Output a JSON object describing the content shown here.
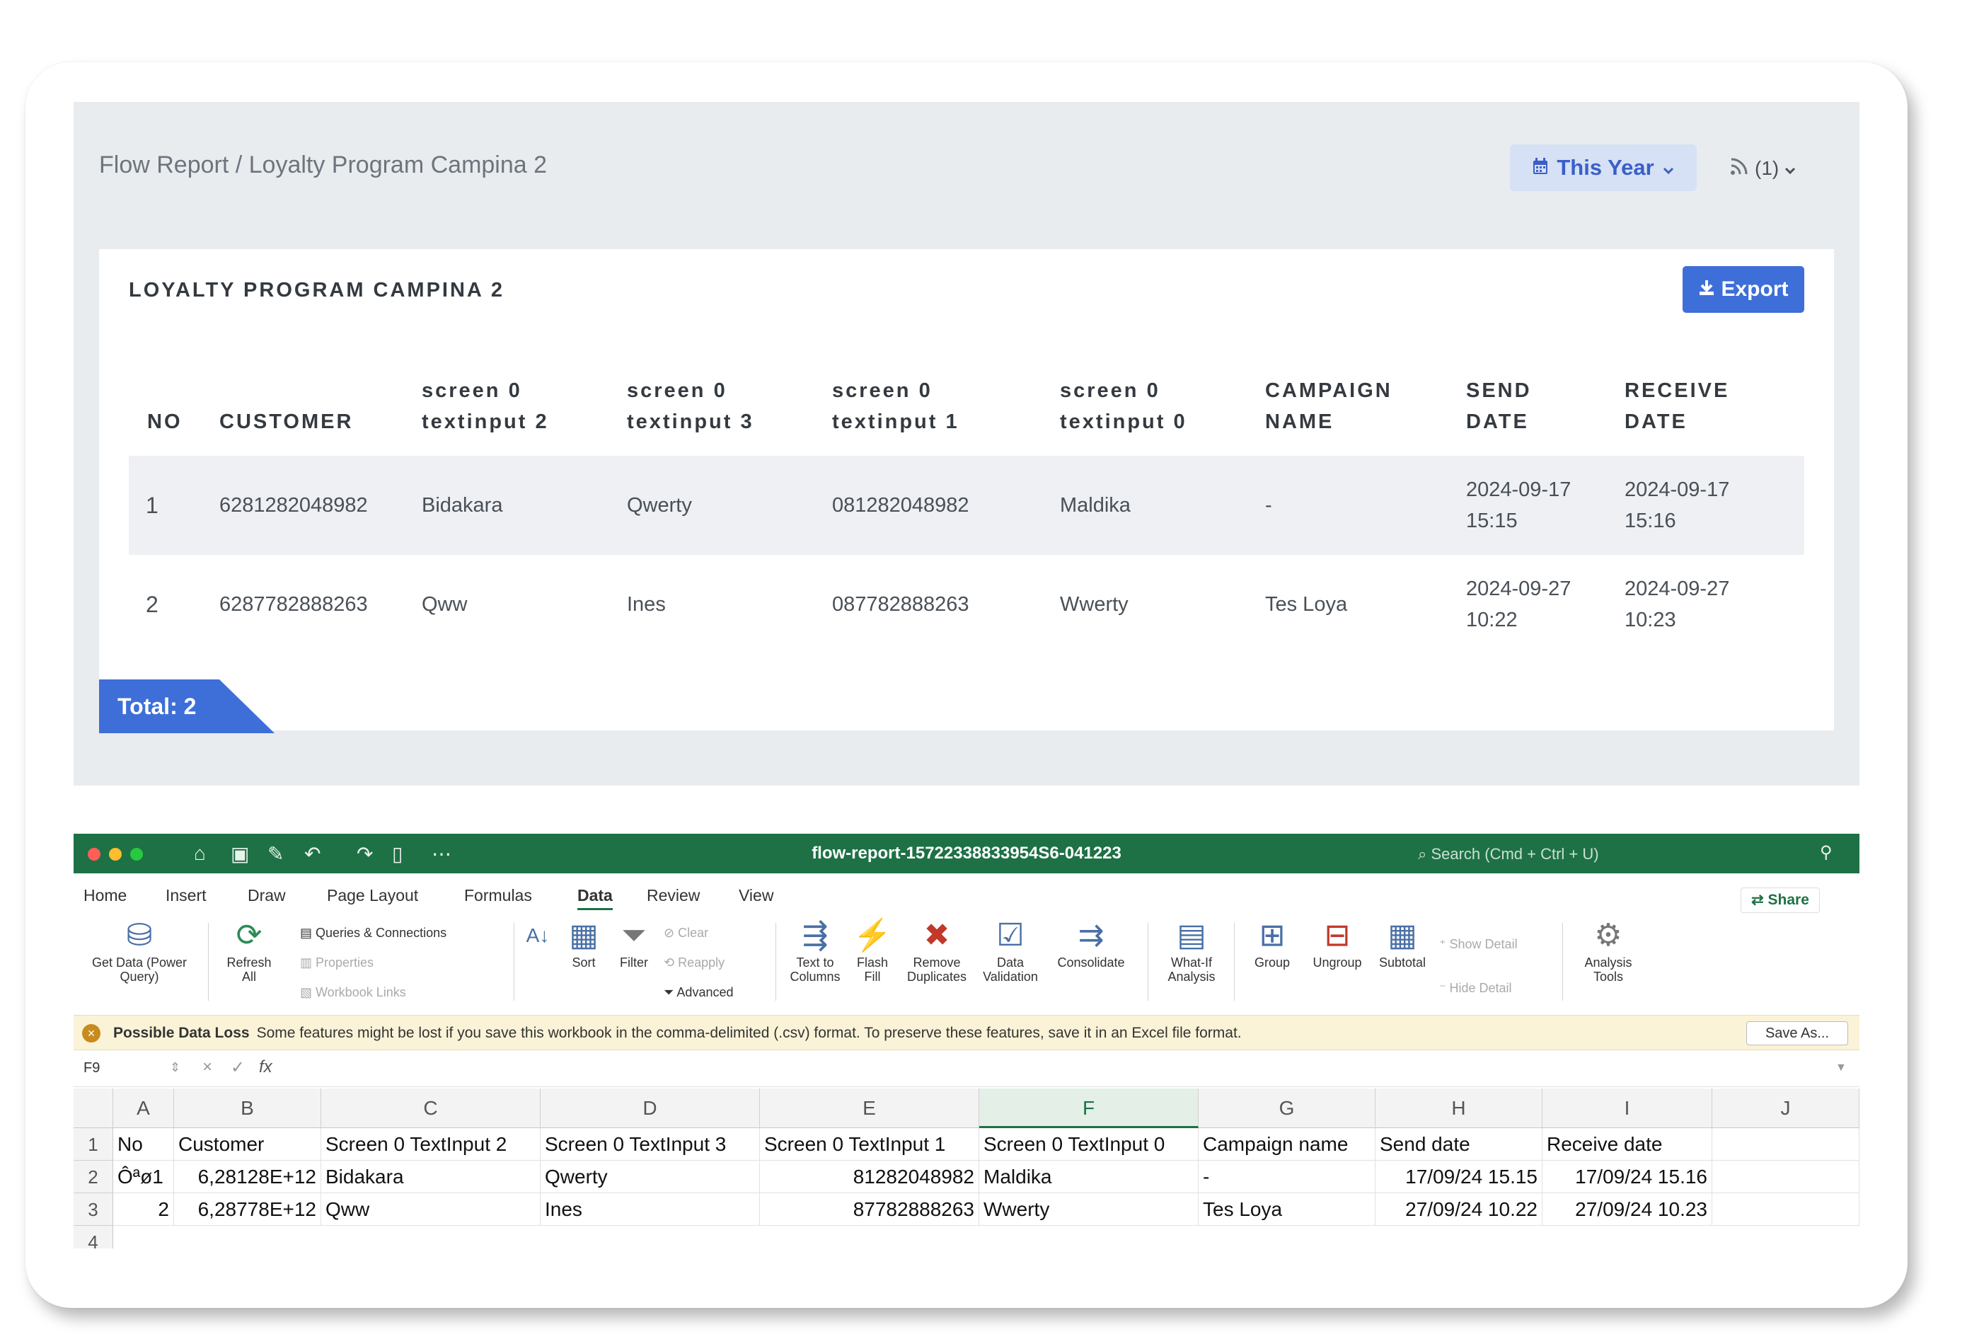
{
  "report": {
    "breadcrumb": "Flow Report / Loyalty Program Campina 2",
    "period_button": "This Year",
    "feed_count": "(1)",
    "panel_title": "LOYALTY PROGRAM CAMPINA 2",
    "export_label": "Export",
    "headers": {
      "no": "NO",
      "customer": "CUSTOMER",
      "ti2_a": "screen 0",
      "ti2_b": "textinput 2",
      "ti3_a": "screen 0",
      "ti3_b": "textinput 3",
      "ti1_a": "screen 0",
      "ti1_b": "textinput 1",
      "ti0_a": "screen 0",
      "ti0_b": "textinput 0",
      "campaign_a": "CAMPAIGN",
      "campaign_b": "NAME",
      "send_a": "SEND",
      "send_b": "DATE",
      "recv_a": "RECEIVE",
      "recv_b": "DATE"
    },
    "rows": [
      {
        "no": "1",
        "customer": "6281282048982",
        "ti2": "Bidakara",
        "ti3": "Qwerty",
        "ti1": "081282048982",
        "ti0": "Maldika",
        "campaign": "-",
        "send_date": "2024-09-17",
        "send_time": "15:15",
        "recv_date": "2024-09-17",
        "recv_time": "15:16"
      },
      {
        "no": "2",
        "customer": "6287782888263",
        "ti2": "Qww",
        "ti3": "Ines",
        "ti1": "087782888263",
        "ti0": "Wwerty",
        "campaign": "Tes Loya",
        "send_date": "2024-09-27",
        "send_time": "10:22",
        "recv_date": "2024-09-27",
        "recv_time": "10:23"
      }
    ],
    "total": "Total: 2",
    "colors": {
      "accent": "#3e6fd8",
      "page_bg": "#e9ecef"
    }
  },
  "excel": {
    "file_title": "flow-report-15722338833954S6-041223",
    "search_placeholder": "Search (Cmd + Ctrl + U)",
    "tabs": [
      "Home",
      "Insert",
      "Draw",
      "Page Layout",
      "Formulas",
      "Data",
      "Review",
      "View"
    ],
    "share_label": "Share",
    "ribbon": {
      "get_data": "Get Data (Power Query)",
      "refresh_all": "Refresh All",
      "queries": "Queries & Connections",
      "properties": "Properties",
      "workbook_links": "Workbook Links",
      "sort": "Sort",
      "filter": "Filter",
      "clear": "Clear",
      "reapply": "Reapply",
      "advanced": "Advanced",
      "text_to_columns": "Text to Columns",
      "flash_fill": "Flash Fill",
      "remove_duplicates": "Remove Duplicates",
      "data_validation": "Data Validation",
      "consolidate": "Consolidate",
      "what_if": "What-If Analysis",
      "group": "Group",
      "ungroup": "Ungroup",
      "subtotal": "Subtotal",
      "show_detail": "Show Detail",
      "hide_detail": "Hide Detail",
      "analysis_tools": "Analysis Tools"
    },
    "warning_title": "Possible Data Loss",
    "warning_text": "Some features might be lost if you save this workbook in the comma-delimited (.csv) format. To preserve these features, save it in an Excel file format.",
    "save_as": "Save As...",
    "name_box": "F9",
    "columns": [
      "A",
      "B",
      "C",
      "D",
      "E",
      "F",
      "G",
      "H",
      "I",
      "J"
    ],
    "selected_column": "F",
    "row_numbers": [
      "1",
      "2",
      "3",
      "4"
    ],
    "rows": [
      [
        "No",
        "Customer",
        "Screen 0 TextInput 2",
        "Screen 0 TextInput 3",
        "Screen 0 TextInput 1",
        "Screen 0 TextInput 0",
        "Campaign name",
        "Send date",
        "Receive date",
        ""
      ],
      [
        "Ôªø1",
        "6,28128E+12",
        "Bidakara",
        "Qwerty",
        "81282048982",
        "Maldika",
        "-",
        "17/09/24 15.15",
        "17/09/24 15.16",
        ""
      ],
      [
        "2",
        "6,28778E+12",
        "Qww",
        "Ines",
        "87782888263",
        "Wwerty",
        "Tes Loya",
        "27/09/24 10.22",
        "27/09/24 10.23",
        ""
      ]
    ],
    "colors": {
      "titlebar": "#1e7145"
    }
  }
}
